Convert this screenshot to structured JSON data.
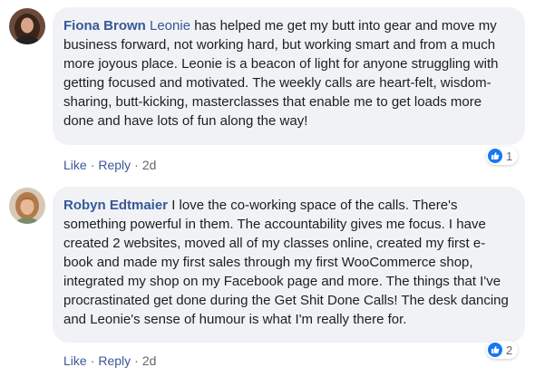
{
  "comments": [
    {
      "author": "Fiona Brown",
      "mention": "Leonie",
      "text": " has helped me get my butt into gear and move my business forward, not working hard, but working smart and from a much more joyous place. Leonie is a beacon of light for anyone struggling with getting focused and motivated. The weekly calls are heart-felt, wisdom-sharing, butt-kicking, masterclasses that enable me to get loads more done and have lots of fun along the way!",
      "reaction_count": "1",
      "like_label": "Like",
      "reply_label": "Reply",
      "timestamp": "2d"
    },
    {
      "author": "Robyn Edtmaier",
      "mention": "",
      "text": " I love the co-working space of the calls. There's something powerful in them. The accountability gives me focus. I have created 2 websites, moved all of my classes online, created my first e-book and made my first sales through my first WooCommerce shop, integrated my shop on my Facebook page and more. The things that I've procrastinated get done during the Get Shit Done Calls! The desk dancing and Leonie's sense of humour is what I'm really there for.",
      "reaction_count": "2",
      "like_label": "Like",
      "reply_label": "Reply",
      "timestamp": "2d"
    }
  ],
  "colors": {
    "link": "#385898",
    "bubble": "#f0f2f5",
    "like_badge": "#1877f2",
    "meta": "#65676b"
  }
}
